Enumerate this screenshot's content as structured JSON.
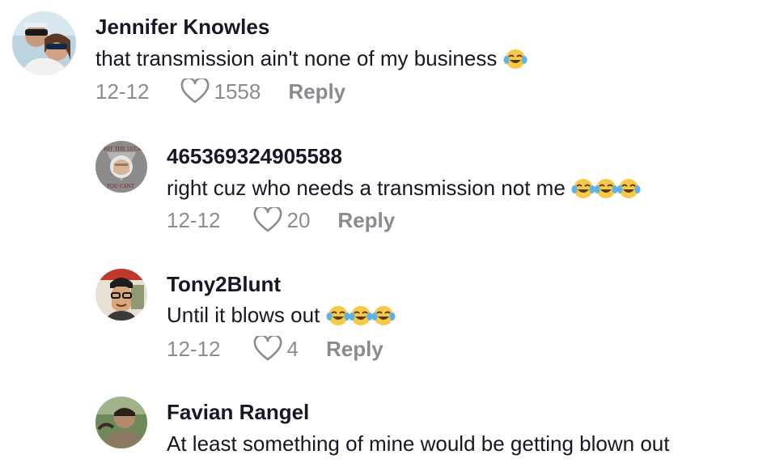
{
  "comments": [
    {
      "username": "Jennifer Knowles",
      "text": "that transmission ain't none of my business",
      "emoji": "😂",
      "date": "12-12",
      "likes": "1558",
      "reply_label": "Reply",
      "avatar": "avatar-couple-sunglasses"
    },
    {
      "username": "465369324905588",
      "text": "right cuz who needs a transmission not me",
      "emoji": "😂😂😂",
      "date": "12-12",
      "likes": "20",
      "reply_label": "Reply",
      "avatar": "avatar-fist-punch"
    },
    {
      "username": "Tony2Blunt",
      "text": "Until it blows out",
      "emoji": "😂😂😂",
      "date": "12-12",
      "likes": "4",
      "reply_label": "Reply",
      "avatar": "avatar-cartoon-man"
    },
    {
      "username": "Favian Rangel",
      "text": "At least something of mine would be getting blown out",
      "emoji": "",
      "date": "",
      "likes": "",
      "reply_label": "",
      "avatar": "avatar-person-outdoor"
    }
  ],
  "colors": {
    "text_primary": "#161823",
    "text_secondary": "#8a8b91",
    "background": "#ffffff"
  },
  "icons": {
    "like": "heart-outline-icon",
    "emoji": "face-with-tears-of-joy"
  }
}
